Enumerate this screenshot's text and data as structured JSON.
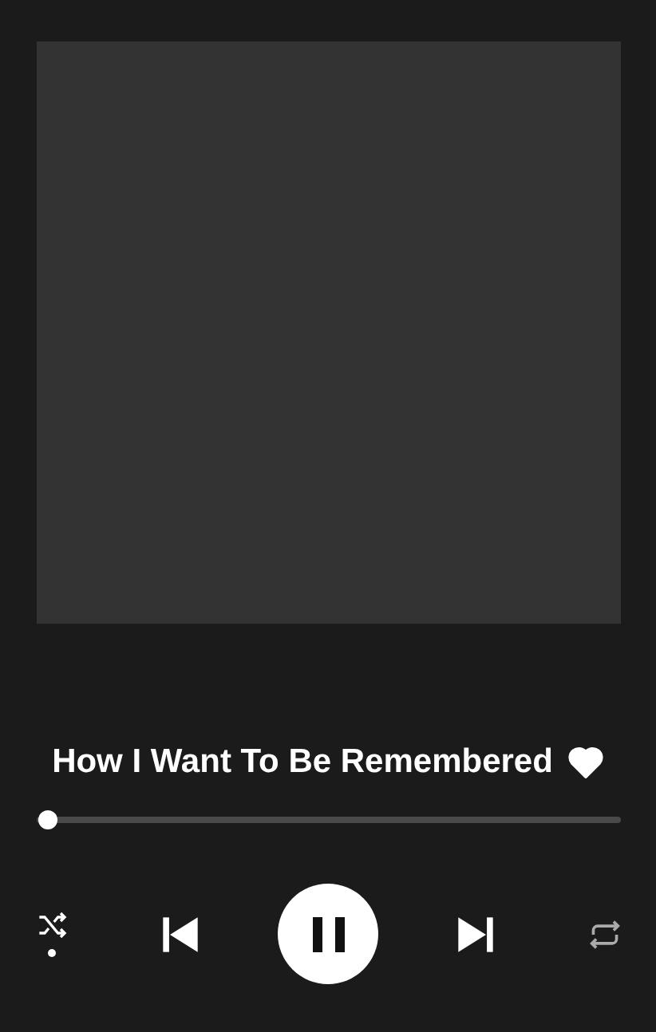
{
  "track": {
    "title": "How I Want To Be Remembered",
    "liked": true
  },
  "progress": {
    "level": 0.02
  },
  "controls": {
    "shuffle_on": true,
    "repeat_on": false,
    "playing": true
  }
}
